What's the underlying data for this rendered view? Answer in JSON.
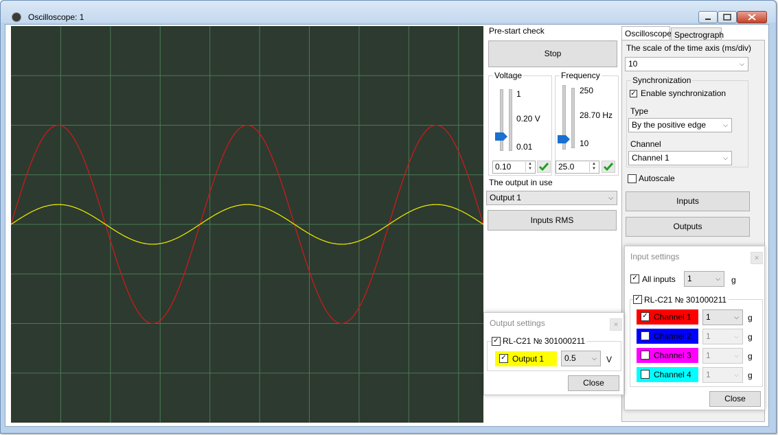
{
  "window": {
    "title": "Oscilloscope: 1"
  },
  "scope": {
    "background": "#2d3a2f",
    "grid_color": "#4a7a55",
    "series": [
      {
        "color": "#cc1a1a",
        "amplitude_div": 2.0,
        "cycles_shown": 2.5
      },
      {
        "color": "#e6e600",
        "amplitude_div": 0.4,
        "cycles_shown": 2.5
      }
    ]
  },
  "control": {
    "prestart_label": "Pre-start check",
    "stop_label": "Stop",
    "voltage": {
      "label": "Voltage",
      "max": "1",
      "current": "0.20 V",
      "min": "0.01",
      "value": "0.10"
    },
    "frequency": {
      "label": "Frequency",
      "max": "250",
      "current": "28.70 Hz",
      "min": "10",
      "value": "25.0"
    },
    "output_label": "The output in use",
    "output_value": "Output 1",
    "inputs_rms_label": "Inputs RMS"
  },
  "tabs": {
    "oscilloscope": "Oscilloscope",
    "spectrograph": "Spectrograph"
  },
  "settings": {
    "time_axis_label": "The scale of the time axis  (ms/div)",
    "time_axis_value": "10",
    "sync_group": "Synchronization",
    "enable_sync": "Enable synchronization",
    "type_label": "Type",
    "type_value": "By the positive edge",
    "channel_label": "Channel",
    "channel_value": "Channel 1",
    "autoscale": "Autoscale",
    "inputs_button": "Inputs",
    "outputs_button": "Outputs"
  },
  "input_settings": {
    "title": "Input settings",
    "all_inputs": "All inputs",
    "all_value": "1",
    "unit": "g",
    "device": "RL-C21 № 301000211",
    "channels": [
      {
        "label": "Channel 1",
        "color": "#ff0000",
        "checked": true,
        "value": "1"
      },
      {
        "label": "Channel 2",
        "color": "#0000ff",
        "checked": false,
        "value": "1"
      },
      {
        "label": "Channel 3",
        "color": "#ff00ff",
        "checked": false,
        "value": "1"
      },
      {
        "label": "Channel 4",
        "color": "#00ffff",
        "checked": false,
        "value": "1"
      }
    ],
    "close": "Close"
  },
  "output_settings": {
    "title": "Output settings",
    "device": "RL-C21 № 301000211",
    "output_label": "Output 1",
    "output_color": "#ffff00",
    "value": "0.5",
    "unit": "V",
    "close": "Close"
  }
}
